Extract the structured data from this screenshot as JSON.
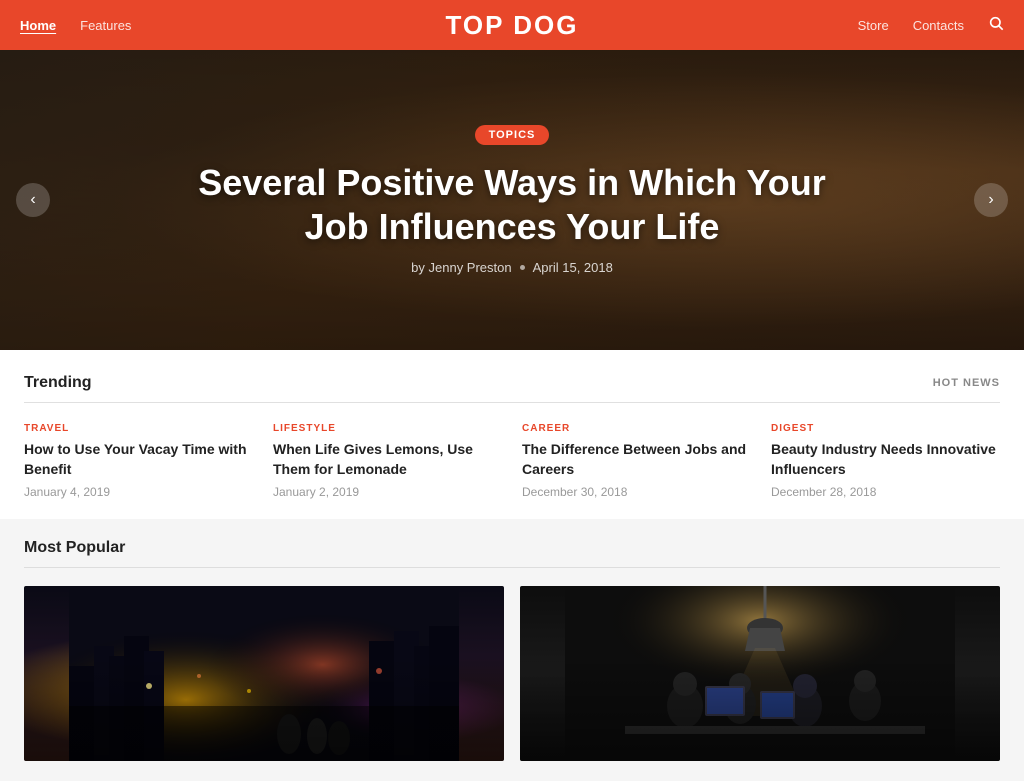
{
  "header": {
    "logo": "TOP DOG",
    "nav": {
      "home": "Home",
      "features": "Features",
      "store": "Store",
      "contacts": "Contacts"
    },
    "search_label": "search"
  },
  "hero": {
    "badge": "topics",
    "title": "Several Positive Ways in Which Your Job Influences Your Life",
    "author": "by Jenny Preston",
    "date": "April 15, 2018",
    "prev_label": "‹",
    "next_label": "›"
  },
  "trending": {
    "section_title": "Trending",
    "hot_news_label": "HOT NEWS",
    "items": [
      {
        "category": "TRAVEL",
        "title": "How to Use Your Vacay Time with Benefit",
        "date": "January 4, 2019"
      },
      {
        "category": "LIFESTYLE",
        "title": "When Life Gives Lemons, Use Them for Lemonade",
        "date": "January 2, 2019"
      },
      {
        "category": "CAREER",
        "title": "The Difference Between Jobs and Careers",
        "date": "December 30, 2018"
      },
      {
        "category": "DIGEST",
        "title": "Beauty Industry Needs Innovative Influencers",
        "date": "December 28, 2018"
      }
    ]
  },
  "most_popular": {
    "section_title": "Most Popular",
    "cards": [
      {
        "image_type": "city",
        "alt": "City street at night with people"
      },
      {
        "image_type": "office",
        "alt": "People working in office"
      }
    ]
  }
}
